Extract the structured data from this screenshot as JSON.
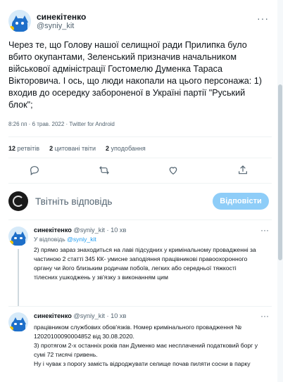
{
  "tweet": {
    "author_name": "синекітенко",
    "author_handle": "@syniy_kit",
    "text": "Через те, що Голову нашої селищної ради Прилипка було вбито окупантами, Зеленський призначив начальником військової адміністрації Гостомелю Думенка Тараса Вікторовича. І ось, що люди накопали на цього персонажа: 1) входив до осередку забороненої в Україні партії \"Руський блок\";",
    "time": "8:26 пп · 6 трав. 2022 · ",
    "client": "Twitter for Android"
  },
  "stats": {
    "retweets_count": "12",
    "retweets_label": "ретвітів",
    "quotes_count": "2",
    "quotes_label": "цитовані твіти",
    "likes_count": "2",
    "likes_label": "уподобання"
  },
  "actions": [
    "reply-icon",
    "retweet-icon",
    "like-icon",
    "share-icon"
  ],
  "reply_box": {
    "placeholder": "Твітніть відповідь",
    "button_label": "Відповісти"
  },
  "replies": [
    {
      "author_name": "синекітенко",
      "author_handle": "@syniy_kit",
      "time": "· 10 хв",
      "replying_prefix": "У відповідь ",
      "replying_handle": "@syniy_kit",
      "text": "2) прямо зараз знаходиться на лаві підсудних у кримінальному провадженні за частиною 2 статті 345 КК- умисне заподіяння працівникові правоохоронного органу чи його близьким родичам побоїв, легких або середньої тяжкості тілесних ушкоджень у зв'язку з виконанням цим"
    },
    {
      "author_name": "синекітенко",
      "author_handle": "@syniy_kit",
      "time": "· 10 хв",
      "text": "працівником службових обов'язків. Номер кримінального провадження № 12020100090004852 від 30.08.2020.\n3) протягом 2-х останніх років пан Думенко має несплачений податковий борг у сумі 72 тисячі гривень.\nНу і чувак з порогу замість відроджувати селище почав пиляти сосни в парку"
    }
  ],
  "colors": {
    "accent": "#1d9bf0",
    "reply_button_disabled": "#8ecdf8",
    "secondary_text": "#536471"
  }
}
